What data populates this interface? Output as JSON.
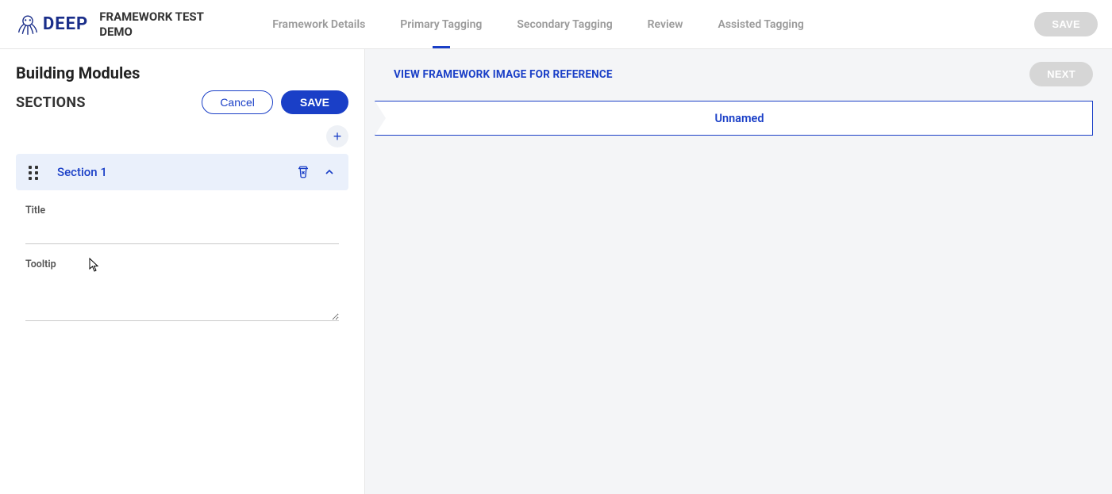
{
  "header": {
    "logo_text": "DEEP",
    "project_title": "FRAMEWORK TEST DEMO",
    "tabs": [
      {
        "label": "Framework Details",
        "active": false
      },
      {
        "label": "Primary Tagging",
        "active": true
      },
      {
        "label": "Secondary Tagging",
        "active": false
      },
      {
        "label": "Review",
        "active": false
      },
      {
        "label": "Assisted Tagging",
        "active": false
      }
    ],
    "save_label": "SAVE"
  },
  "sidebar": {
    "page_title": "Building Modules",
    "sections_label": "SECTIONS",
    "cancel_label": "Cancel",
    "save_label": "SAVE",
    "section": {
      "name": "Section 1",
      "title_label": "Title",
      "title_value": "",
      "tooltip_label": "Tooltip",
      "tooltip_value": ""
    }
  },
  "content": {
    "view_ref_label": "VIEW FRAMEWORK IMAGE FOR REFERENCE",
    "next_label": "NEXT",
    "breadcrumb_label": "Unnamed"
  }
}
